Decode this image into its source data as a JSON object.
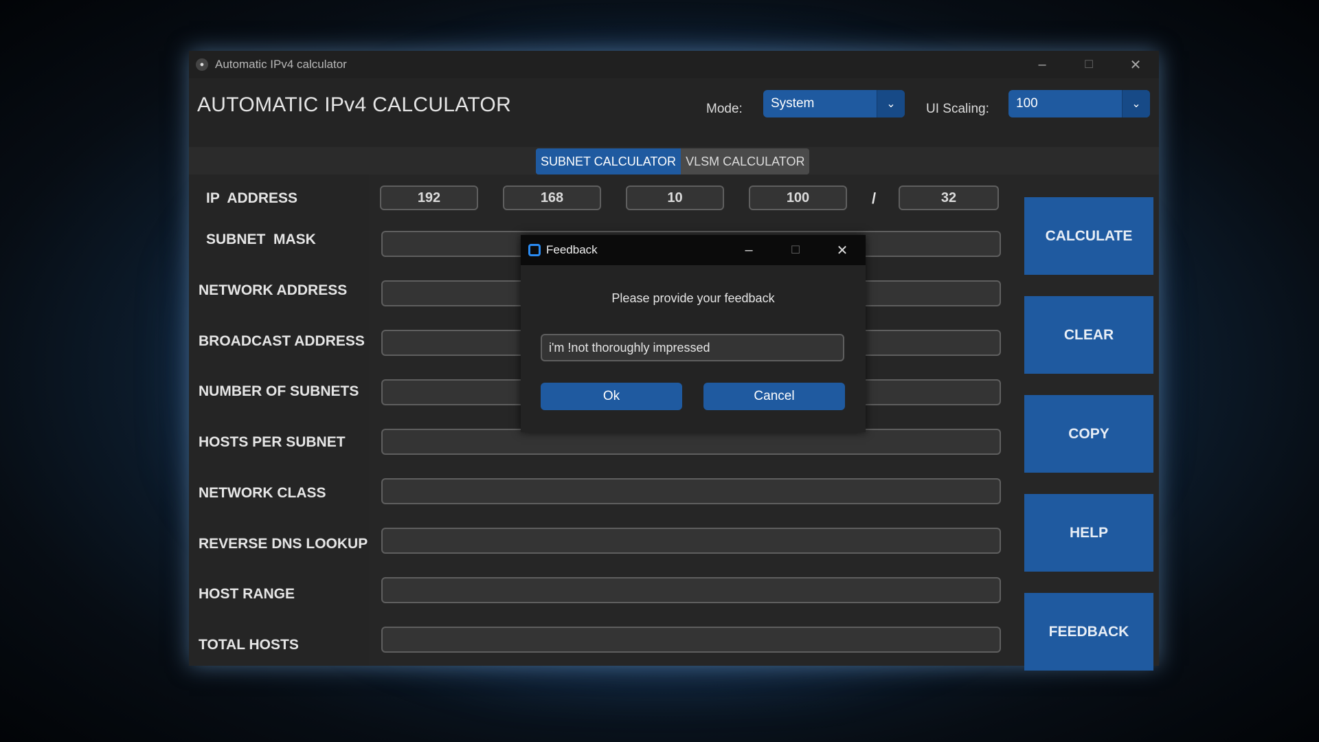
{
  "window": {
    "title": "Automatic IPv4 calculator",
    "minimize": "–",
    "maximize": "☐",
    "close": "✕"
  },
  "header": {
    "app_title": "AUTOMATIC IPv4 CALCULATOR",
    "mode_label": "Mode:",
    "mode_value": "System",
    "scaling_label": "UI Scaling:",
    "scaling_value": "100",
    "dropdown_arrow": "⌄"
  },
  "tabs": [
    {
      "label": "SUBNET CALCULATOR",
      "active": true
    },
    {
      "label": "VLSM CALCULATOR",
      "active": false
    }
  ],
  "form": {
    "ip_label": "IP  ADDRESS",
    "octets": [
      "192",
      "168",
      "10",
      "100"
    ],
    "slash": "/",
    "prefix": "32",
    "rows": [
      {
        "label": "SUBNET  MASK"
      },
      {
        "label": "NETWORK ADDRESS"
      },
      {
        "label": "BROADCAST ADDRESS"
      },
      {
        "label": "NUMBER OF SUBNETS"
      },
      {
        "label": "HOSTS PER SUBNET"
      },
      {
        "label": "NETWORK CLASS"
      },
      {
        "label": "REVERSE DNS LOOKUP"
      },
      {
        "label": "HOST RANGE"
      },
      {
        "label": "TOTAL HOSTS"
      }
    ]
  },
  "actions": [
    "CALCULATE",
    "CLEAR",
    "COPY",
    "HELP",
    "FEEDBACK"
  ],
  "dialog": {
    "title": "Feedback",
    "prompt": "Please provide your feedback",
    "input_value": "i'm !not thoroughly impressed",
    "ok_label": "Ok",
    "cancel_label": "Cancel",
    "minimize": "–",
    "maximize": "☐",
    "close": "✕"
  },
  "colors": {
    "accent": "#1f5aa0",
    "background": "#242424",
    "field_border": "#5f5f5f"
  }
}
